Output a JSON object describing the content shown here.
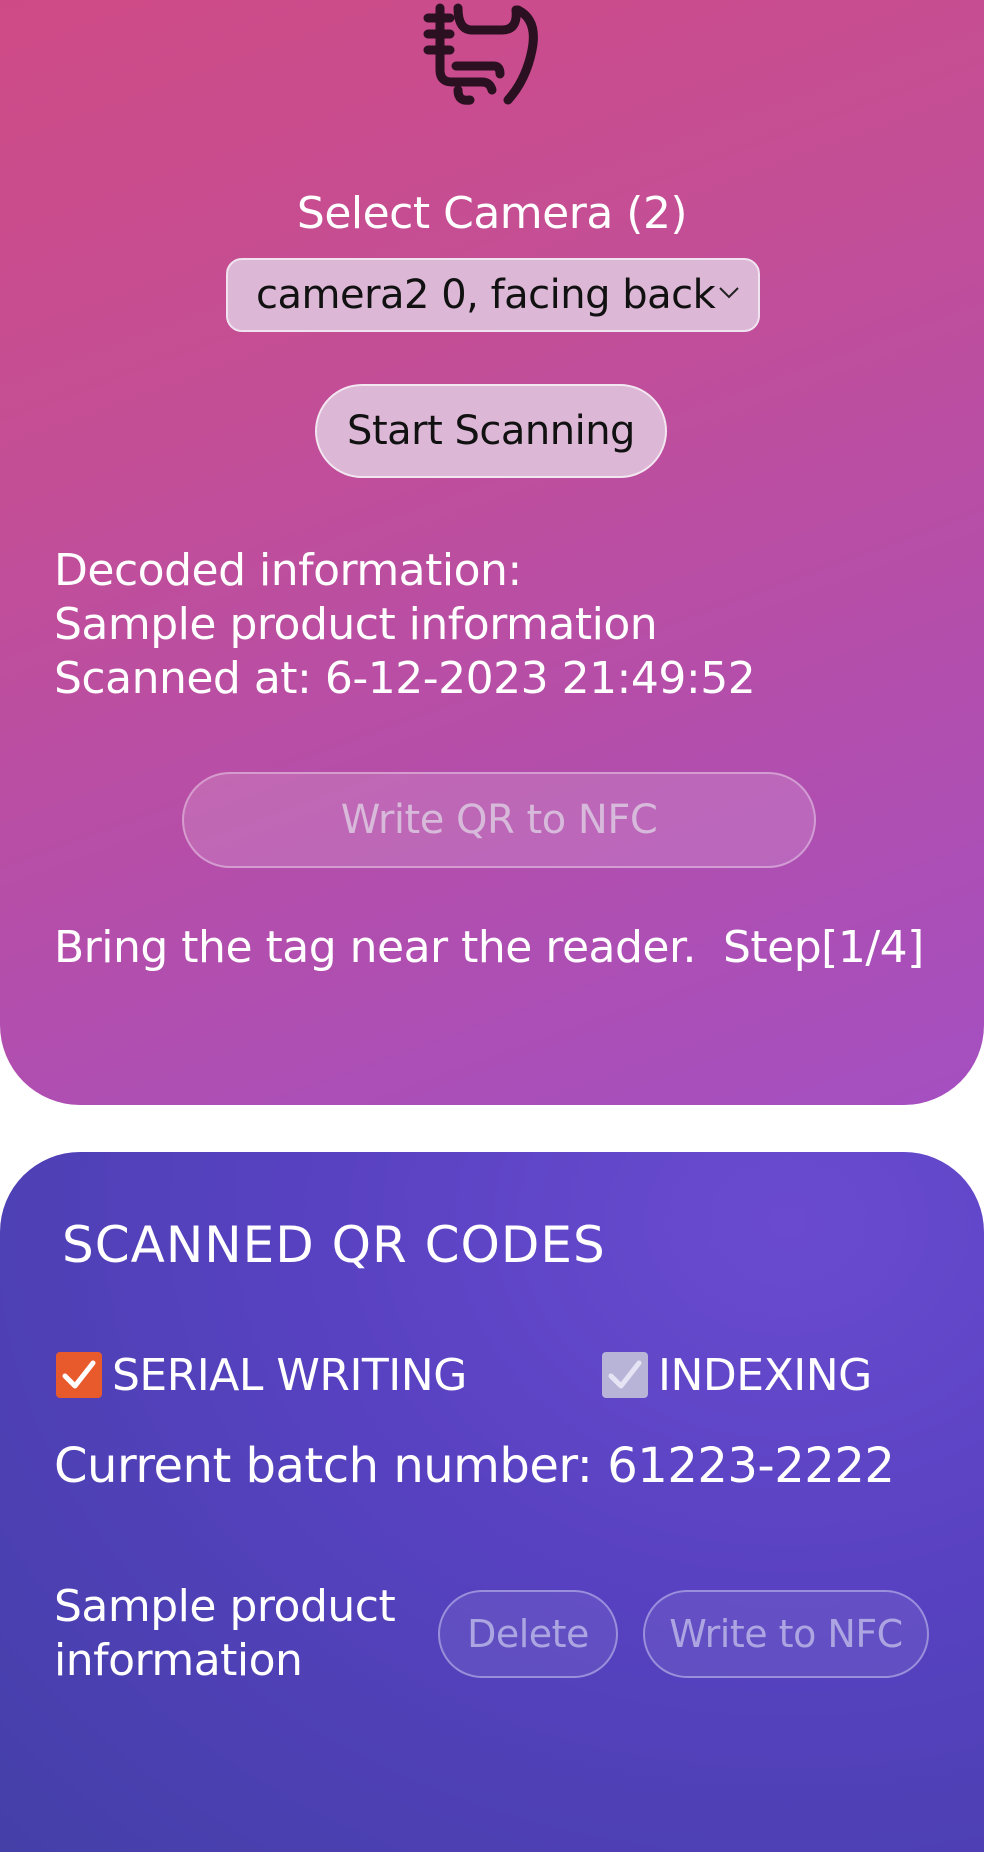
{
  "camera": {
    "select_label": "Select Camera (2)",
    "selected_option": "camera2 0, facing back",
    "start_button": "Start Scanning"
  },
  "decoded": {
    "heading": "Decoded information:",
    "value": "Sample product information",
    "scanned_at": "Scanned at: 6-12-2023 21:49:52"
  },
  "write_qr_button": "Write QR to NFC",
  "nfc_status": "Bring the tag near the reader.  Step[1/4]",
  "scanned": {
    "title": "SCANNED QR CODES",
    "serial_writing_label": "SERIAL WRITING",
    "serial_writing_checked": true,
    "indexing_label": "INDEXING",
    "indexing_checked": true,
    "batch": "Current batch number: 61223-2222",
    "items": [
      {
        "text": "Sample product information",
        "delete_label": "Delete",
        "write_label": "Write to NFC"
      }
    ]
  },
  "colors": {
    "top_card_start": "#d04a84",
    "top_card_end": "#a44fc1",
    "bottom_card": "#5741c0",
    "serial_checkbox": "#e85a2c",
    "indexing_checkbox": "#b8b4d8"
  },
  "icons": {
    "header": "hand-pointing-icon",
    "select_arrow": "chevron-down-icon",
    "checkbox_mark": "check-icon"
  }
}
